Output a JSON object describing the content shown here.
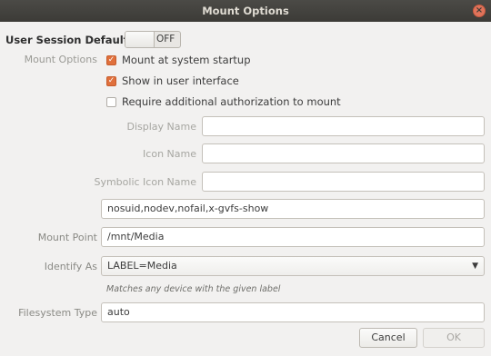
{
  "window": {
    "title": "Mount Options",
    "close_glyph": "×"
  },
  "session": {
    "label": "User Session Defaults",
    "switch_state": "OFF"
  },
  "mount_options": {
    "label": "Mount Options",
    "mount_at_startup": {
      "label": "Mount at system startup",
      "checked": true
    },
    "show_in_ui": {
      "label": "Show in user interface",
      "checked": true
    },
    "require_auth": {
      "label": "Require additional authorization to mount",
      "checked": false
    }
  },
  "fields": {
    "display_name": {
      "label": "Display Name",
      "value": ""
    },
    "icon_name": {
      "label": "Icon Name",
      "value": ""
    },
    "symbolic_icon_name": {
      "label": "Symbolic Icon Name",
      "value": ""
    },
    "options": {
      "value": "nosuid,nodev,nofail,x-gvfs-show"
    },
    "mount_point": {
      "label": "Mount Point",
      "value": "/mnt/Media"
    },
    "identify_as": {
      "label": "Identify As",
      "value": "LABEL=Media",
      "hint": "Matches any device with the given label"
    },
    "filesystem_type": {
      "label": "Filesystem Type",
      "value": "auto"
    }
  },
  "buttons": {
    "cancel": "Cancel",
    "ok": "OK"
  },
  "colors": {
    "accent": "#e0703c",
    "titlebar": "#3c3b37",
    "close": "#e0735a"
  }
}
